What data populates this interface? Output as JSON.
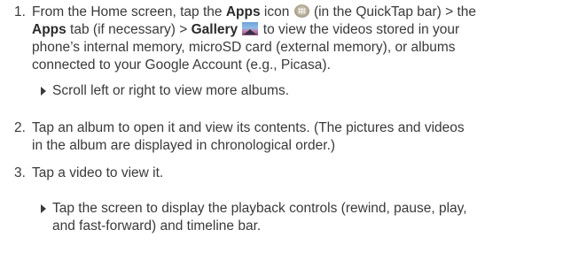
{
  "steps": [
    {
      "number": "1.",
      "lines": [
        [
          "From the Home screen, tap the ",
          "Apps",
          " icon ",
          "",
          " (in the QuickTap bar) > the"
        ],
        [
          "Apps",
          " tab (if necessary) > ",
          "Gallery",
          "",
          " to view the videos stored in your"
        ],
        [
          "phone’s internal memory, microSD card (external memory), or albums"
        ],
        [
          "connected to your Google Account (e.g., Picasa)."
        ]
      ],
      "bullet": [
        "Scroll left or right to view more albums."
      ]
    },
    {
      "number": "2.",
      "lines": [
        [
          "Tap an album to open it and view its contents. (The pictures and videos"
        ],
        [
          "in the album are displayed in chronological order.)"
        ]
      ]
    },
    {
      "number": "3.",
      "lines": [
        [
          "Tap a video to view it."
        ]
      ],
      "bullet": [
        "Tap the screen to display the playback controls (rewind, pause, play,",
        "and fast-forward) and timeline bar."
      ]
    }
  ],
  "icons": {
    "apps": "apps-icon",
    "gallery": "gallery-icon"
  }
}
